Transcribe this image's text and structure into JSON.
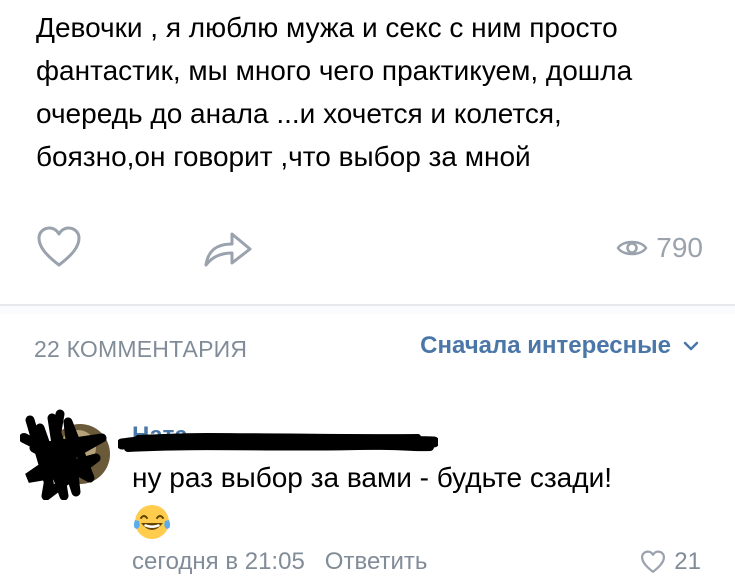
{
  "post": {
    "text": "Девочки , я люблю мужа и секс с ним просто\nфантастик, мы много чего практикуем, дошла\nочередь  до анала ...и хочется и колется,\nбоязно,он говорит ,что выбор за мной"
  },
  "actions": {
    "like_icon": "heart-outline-icon",
    "share_icon": "share-arrow-icon",
    "views_icon": "eye-icon",
    "views_count": "790"
  },
  "comments": {
    "count_label": "22 КОММЕНТАРИЯ",
    "sort_label": "Сначала интересные",
    "sort_icon": "chevron-down-icon",
    "items": [
      {
        "author": "Ната",
        "text": "ну раз выбор за вами - будьте сзади!",
        "emoji": "😂",
        "time": "сегодня в 21:05",
        "reply_label": "Ответить",
        "likes": "21"
      }
    ]
  },
  "colors": {
    "link": "#4a76a8",
    "secondary": "#818c99",
    "icon": "#99a2ad"
  }
}
